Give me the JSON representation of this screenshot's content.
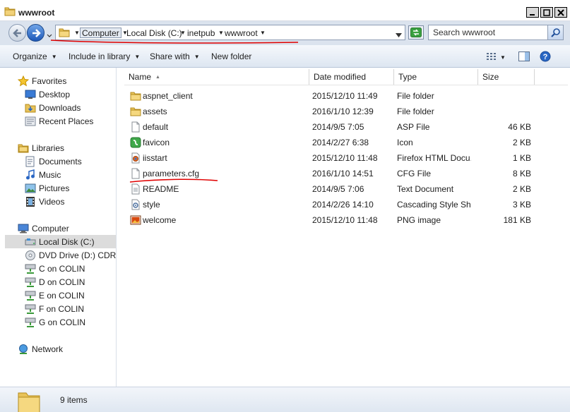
{
  "window": {
    "title": "wwwroot"
  },
  "address": {
    "crumbs": [
      "Computer",
      "Local Disk (C:)",
      "inetpub",
      "wwwroot"
    ]
  },
  "search": {
    "placeholder": "Search wwwroot"
  },
  "toolbar": {
    "organize": "Organize",
    "include": "Include in library",
    "share": "Share with",
    "newfolder": "New folder"
  },
  "nav": {
    "favorites": "Favorites",
    "desktop": "Desktop",
    "downloads": "Downloads",
    "recent": "Recent Places",
    "libraries": "Libraries",
    "documents": "Documents",
    "music": "Music",
    "pictures": "Pictures",
    "videos": "Videos",
    "computer": "Computer",
    "localdisk": "Local Disk (C:)",
    "dvd": "DVD Drive (D:) CDROM",
    "c_colin": "C on COLIN",
    "d_colin": "D on COLIN",
    "e_colin": "E on COLIN",
    "f_colin": "F on COLIN",
    "g_colin": "G on COLIN",
    "network": "Network"
  },
  "columns": {
    "name": "Name",
    "date": "Date modified",
    "type": "Type",
    "size": "Size"
  },
  "files": [
    {
      "name": "aspnet_client",
      "date": "2015/12/10 11:49",
      "type": "File folder",
      "size": "",
      "icon": "folder-icon"
    },
    {
      "name": "assets",
      "date": "2016/1/10 12:39",
      "type": "File folder",
      "size": "",
      "icon": "folder-icon"
    },
    {
      "name": "default",
      "date": "2014/9/5 7:05",
      "type": "ASP File",
      "size": "46 KB",
      "icon": "file-icon"
    },
    {
      "name": "favicon",
      "date": "2014/2/27 6:38",
      "type": "Icon",
      "size": "2 KB",
      "icon": "favicon-icon"
    },
    {
      "name": "iisstart",
      "date": "2015/12/10 11:48",
      "type": "Firefox HTML Docu...",
      "size": "1 KB",
      "icon": "html-icon"
    },
    {
      "name": "parameters.cfg",
      "date": "2016/1/10 14:51",
      "type": "CFG File",
      "size": "8 KB",
      "icon": "file-icon"
    },
    {
      "name": "README",
      "date": "2014/9/5 7:06",
      "type": "Text Document",
      "size": "2 KB",
      "icon": "text-icon"
    },
    {
      "name": "style",
      "date": "2014/2/26 14:10",
      "type": "Cascading Style Sh...",
      "size": "3 KB",
      "icon": "css-icon"
    },
    {
      "name": "welcome",
      "date": "2015/12/10 11:48",
      "type": "PNG image",
      "size": "181 KB",
      "icon": "image-icon"
    }
  ],
  "status": {
    "count": "9 items"
  },
  "colors": {
    "accent": "#1e58b8",
    "annotation": "#e00000",
    "selection": "#dcdcdc"
  }
}
